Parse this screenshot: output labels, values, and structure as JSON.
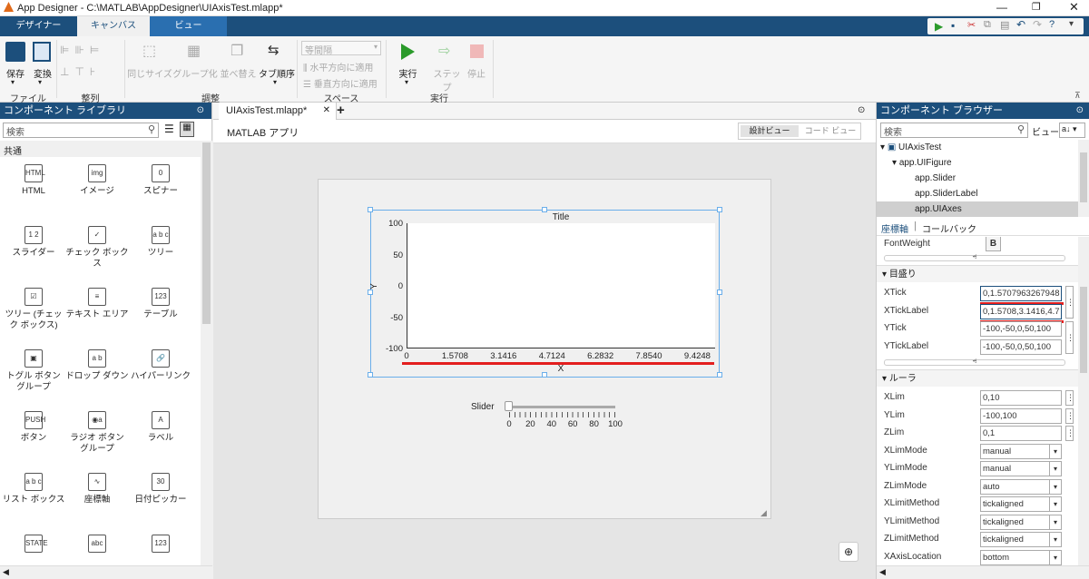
{
  "window": {
    "title": "App Designer - C:\\MATLAB\\AppDesigner\\UIAxisTest.mlapp*"
  },
  "tabs": [
    {
      "label": "デザイナー"
    },
    {
      "label": "キャンバス"
    },
    {
      "label": "ビュー"
    }
  ],
  "ribbon": {
    "file": {
      "save": "保存",
      "convert": "変換",
      "group": "ファイル"
    },
    "align": {
      "group": "整列"
    },
    "arrange": {
      "same_size": "同じサイズ",
      "group_btn": "グループ化",
      "reorder": "並べ替え",
      "tab_order": "タブ順序",
      "group": "調整"
    },
    "spacing": {
      "equal": "等間隔",
      "horizontal": "水平方向に適用",
      "vertical": "垂直方向に適用",
      "group": "スペース"
    },
    "run": {
      "run": "実行",
      "step": "ステップ",
      "stop": "停止",
      "group": "実行"
    }
  },
  "left_panel": {
    "title": "コンポーネント ライブラリ",
    "search_placeholder": "検索",
    "section": "共通",
    "items": [
      {
        "label": "HTML",
        "icon": "HTML"
      },
      {
        "label": "イメージ",
        "icon": "img"
      },
      {
        "label": "スピナー",
        "icon": "0"
      },
      {
        "label": "スライダー",
        "icon": "1 2"
      },
      {
        "label": "チェック ボックス",
        "icon": "✓"
      },
      {
        "label": "ツリー",
        "icon": "a b c"
      },
      {
        "label": "ツリー (チェック ボックス)",
        "icon": "☑"
      },
      {
        "label": "テキスト エリア",
        "icon": "≡"
      },
      {
        "label": "テーブル",
        "icon": "123"
      },
      {
        "label": "トグル ボタン グループ",
        "icon": "▣"
      },
      {
        "label": "ドロップ ダウン",
        "icon": "a b"
      },
      {
        "label": "ハイパーリンク",
        "icon": "🔗"
      },
      {
        "label": "ボタン",
        "icon": "PUSH"
      },
      {
        "label": "ラジオ ボタン グループ",
        "icon": "◉a"
      },
      {
        "label": "ラベル",
        "icon": "A"
      },
      {
        "label": "リスト ボックス",
        "icon": "a b c"
      },
      {
        "label": "座標軸",
        "icon": "∿"
      },
      {
        "label": "日付ピッカー",
        "icon": "30"
      },
      {
        "label": "",
        "icon": "STATE"
      },
      {
        "label": "",
        "icon": "abc"
      },
      {
        "label": "",
        "icon": "123"
      }
    ]
  },
  "canvas": {
    "doc_tab": "UIAxisTest.mlapp*",
    "app_title": "MATLAB アプリ",
    "design_view": "設計ビュー",
    "code_view": "コード ビュー",
    "axes": {
      "title": "Title",
      "xlabel": "X",
      "ylabel": "Y",
      "yticks": [
        "100",
        "50",
        "0",
        "-50",
        "-100"
      ],
      "xticks": [
        "0",
        "1.5708",
        "3.1416",
        "4.7124",
        "6.2832",
        "7.8540",
        "9.4248"
      ]
    },
    "slider": {
      "label": "Slider",
      "ticks": [
        "0",
        "20",
        "40",
        "60",
        "80",
        "100"
      ]
    }
  },
  "right_panel": {
    "title": "コンポーネント ブラウザー",
    "search_placeholder": "検索",
    "view_label": "ビュー",
    "tree": [
      {
        "label": "UIAxisTest"
      },
      {
        "label": "app.UIFigure"
      },
      {
        "label": "app.Slider"
      },
      {
        "label": "app.SliderLabel"
      },
      {
        "label": "app.UIAxes"
      }
    ],
    "tab_props": "座標軸",
    "tab_callbacks": "コールバック",
    "fontweight": {
      "label": "FontWeight",
      "value": "B"
    },
    "ticks_section": "目盛り",
    "ticks": [
      {
        "label": "XTick",
        "value": "0,1.5707963267948"
      },
      {
        "label": "XTickLabel",
        "value": "0,1.5708,3.1416,4.7"
      },
      {
        "label": "YTick",
        "value": "-100,-50,0,50,100"
      },
      {
        "label": "YTickLabel",
        "value": "-100,-50,0,50,100"
      }
    ],
    "ruler_section": "ルーラ",
    "ruler": [
      {
        "label": "XLim",
        "value": "0,10"
      },
      {
        "label": "YLim",
        "value": "-100,100"
      },
      {
        "label": "ZLim",
        "value": "0,1"
      },
      {
        "label": "XLimMode",
        "value": "manual"
      },
      {
        "label": "YLimMode",
        "value": "manual"
      },
      {
        "label": "ZLimMode",
        "value": "auto"
      },
      {
        "label": "XLimitMethod",
        "value": "tickaligned"
      },
      {
        "label": "YLimitMethod",
        "value": "tickaligned"
      },
      {
        "label": "ZLimitMethod",
        "value": "tickaligned"
      },
      {
        "label": "XAxisLocation",
        "value": "bottom"
      }
    ]
  },
  "colors": {
    "accent": "#1c4f7c",
    "highlight": "#e31e1e"
  }
}
